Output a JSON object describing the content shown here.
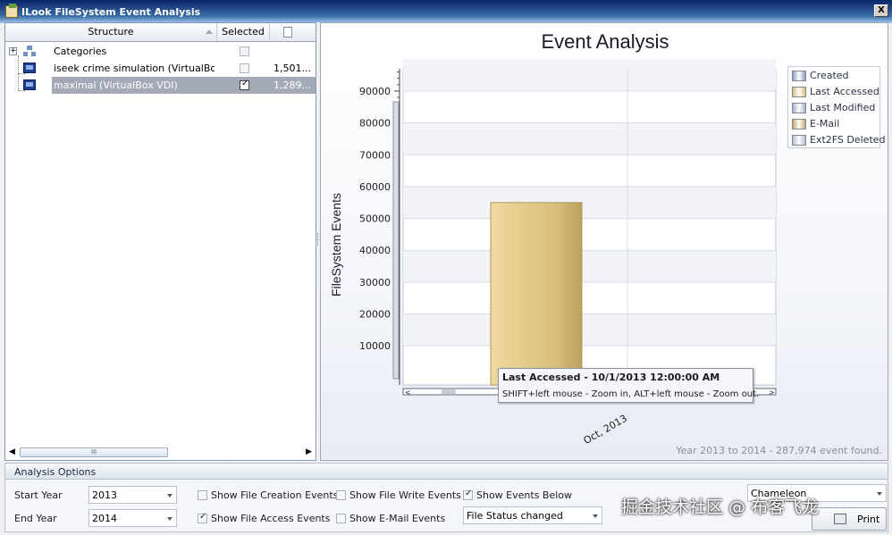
{
  "window": {
    "title": "ILook FileSystem Event Analysis",
    "close_label": "X"
  },
  "tree": {
    "columns": {
      "structure": "Structure",
      "selected": "Selected"
    },
    "rows": [
      {
        "label": "Categories",
        "selected": false,
        "count": "",
        "expander": "+"
      },
      {
        "label": "iseek crime simulation (VirtualBox ...",
        "selected": false,
        "count": "1,501..."
      },
      {
        "label": "maximal (VirtualBox VDI)",
        "selected": true,
        "count": "1,289..."
      }
    ],
    "scroll_left": "◀",
    "scroll_right": "▶",
    "scroll_thumb": "III"
  },
  "chart_data": {
    "type": "bar",
    "title": "Event Analysis",
    "xlabel": "",
    "ylabel": "FileSystem Events",
    "categories": [
      "Oct, 2013"
    ],
    "series": [
      {
        "name": "Created",
        "values": [
          0
        ],
        "color": "#8c9cbe"
      },
      {
        "name": "Last Accessed",
        "values": [
          55000
        ],
        "color": "#d8c07a"
      },
      {
        "name": "Last Modified",
        "values": [
          0
        ],
        "color": "#a4b0c8"
      },
      {
        "name": "E-Mail",
        "values": [
          0
        ],
        "color": "#c8a868"
      },
      {
        "name": "Ext2FS Deleted",
        "values": [
          0
        ],
        "color": "#b4bed2"
      }
    ],
    "yticks": [
      "10000",
      "20000",
      "30000",
      "40000",
      "50000",
      "60000",
      "70000",
      "80000",
      "90000"
    ],
    "ylim": [
      0,
      100000
    ],
    "grid": true,
    "legend_position": "right"
  },
  "chart_footnote": "Year 2013 to 2014 - 287,974 event found.",
  "tooltip": {
    "title": "Last Accessed - 10/1/2013 12:00:00 AM",
    "hint": "SHIFT+left mouse - Zoom in, ALT+left mouse - Zoom out."
  },
  "options": {
    "header": "Analysis Options",
    "start_year_label": "Start Year",
    "start_year_value": "2013",
    "end_year_label": "End Year",
    "end_year_value": "2014",
    "checkboxes": [
      {
        "label": "Show File Creation Events",
        "checked": false
      },
      {
        "label": "Show File Access Events",
        "checked": true
      },
      {
        "label": "Show File Write Events",
        "checked": false
      },
      {
        "label": "Show E-Mail Events",
        "checked": false
      },
      {
        "label": "Show Events Below",
        "checked": true
      }
    ],
    "file_status_value": "File Status changed",
    "theme_value": "Chameleon",
    "print_label": "Print"
  },
  "watermark": "掘金技术社区 @ 布客飞龙"
}
